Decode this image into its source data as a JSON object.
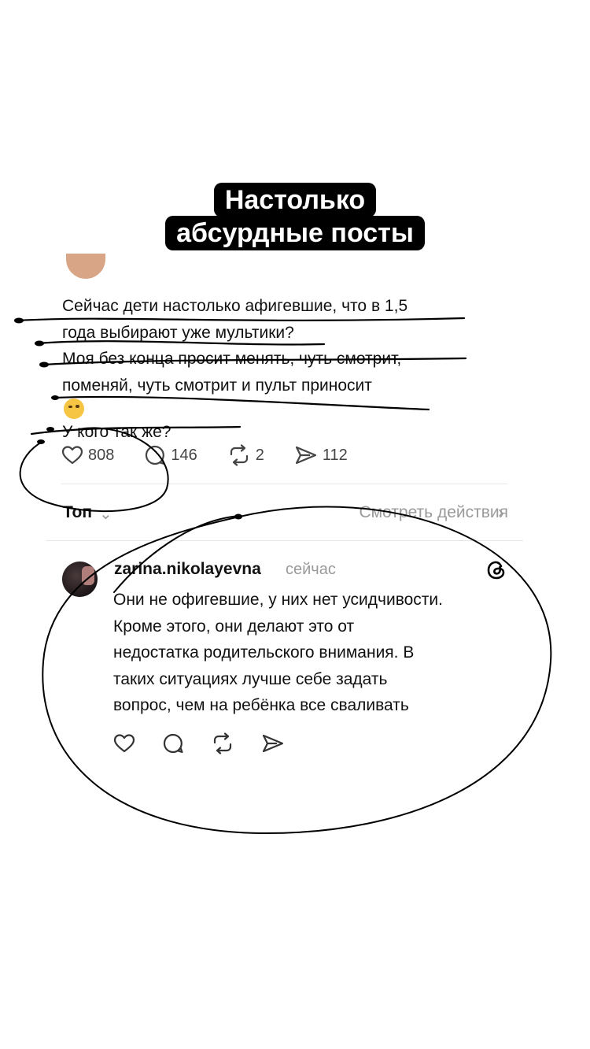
{
  "overlay_title": {
    "line1": "Настолько",
    "line2": "абсурдные посты"
  },
  "post": {
    "text_lines": [
      "Сейчас дети настолько афигевшие, что в 1,5",
      "года выбирают уже мультики?",
      "Моя без конца просит менять, чуть смотрит,",
      "поменяй, чуть смотрит и пульт приносит",
      "У кого так же?"
    ],
    "emoji": "face-with-raised-eyebrow",
    "stats": {
      "likes": "808",
      "comments": "146",
      "reposts": "2",
      "shares": "112"
    }
  },
  "replies_header": {
    "sort": "Топ",
    "view_activity": "Смотреть действия"
  },
  "comment": {
    "username": "zarina.nikolayevna",
    "time": "сейчас",
    "text_lines": [
      "Они не офигевшие, у них нет усидчивости.",
      "Кроме этого, они делают это от",
      "недостатка родительского внимания. В",
      "таких ситуациях лучше себе задать",
      "вопрос, чем на ребёнка все сваливать"
    ]
  },
  "icons": {
    "like": "heart-icon",
    "comment": "speech-bubble-icon",
    "repost": "repost-icon",
    "share": "send-icon",
    "threads": "threads-logo-icon"
  }
}
